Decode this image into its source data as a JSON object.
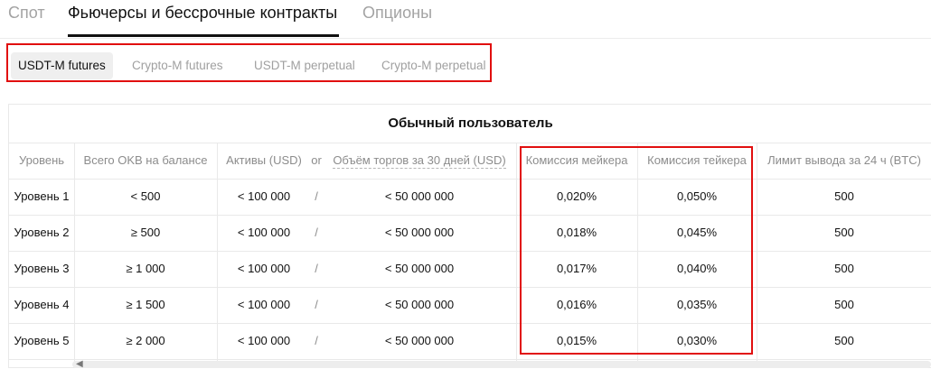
{
  "top_tabs": [
    "Спот",
    "Фьючерсы и бессрочные контракты",
    "Опционы"
  ],
  "sub_tabs": [
    "USDT-M futures",
    "Crypto-M futures",
    "USDT-M perpetual",
    "Crypto-M perpetual"
  ],
  "table": {
    "title": "Обычный пользователь",
    "headers": {
      "level": "Уровень",
      "okb": "Всего OKB на балансе",
      "assets": "Активы (USD)",
      "or": "or",
      "volume": "Объём торгов за 30 дней (USD)",
      "maker": "Комиссия мейкера",
      "taker": "Комиссия тейкера",
      "limit": "Лимит вывода за 24 ч (BTC)"
    },
    "separator": "/",
    "rows": [
      {
        "level": "Уровень 1",
        "okb": "< 500",
        "assets": "< 100 000",
        "volume": "< 50 000 000",
        "maker": "0,020%",
        "taker": "0,050%",
        "limit": "500"
      },
      {
        "level": "Уровень 2",
        "okb": "≥ 500",
        "assets": "< 100 000",
        "volume": "< 50 000 000",
        "maker": "0,018%",
        "taker": "0,045%",
        "limit": "500"
      },
      {
        "level": "Уровень 3",
        "okb": "≥ 1 000",
        "assets": "< 100 000",
        "volume": "< 50 000 000",
        "maker": "0,017%",
        "taker": "0,040%",
        "limit": "500"
      },
      {
        "level": "Уровень 4",
        "okb": "≥ 1 500",
        "assets": "< 100 000",
        "volume": "< 50 000 000",
        "maker": "0,016%",
        "taker": "0,035%",
        "limit": "500"
      },
      {
        "level": "Уровень 5",
        "okb": "≥ 2 000",
        "assets": "< 100 000",
        "volume": "< 50 000 000",
        "maker": "0,015%",
        "taker": "0,030%",
        "limit": "500"
      }
    ]
  },
  "colors": {
    "highlight": "#e10f0f",
    "active_tab_bg": "#efefef"
  },
  "icons": {
    "scroll_left": "chevron-left-icon"
  }
}
